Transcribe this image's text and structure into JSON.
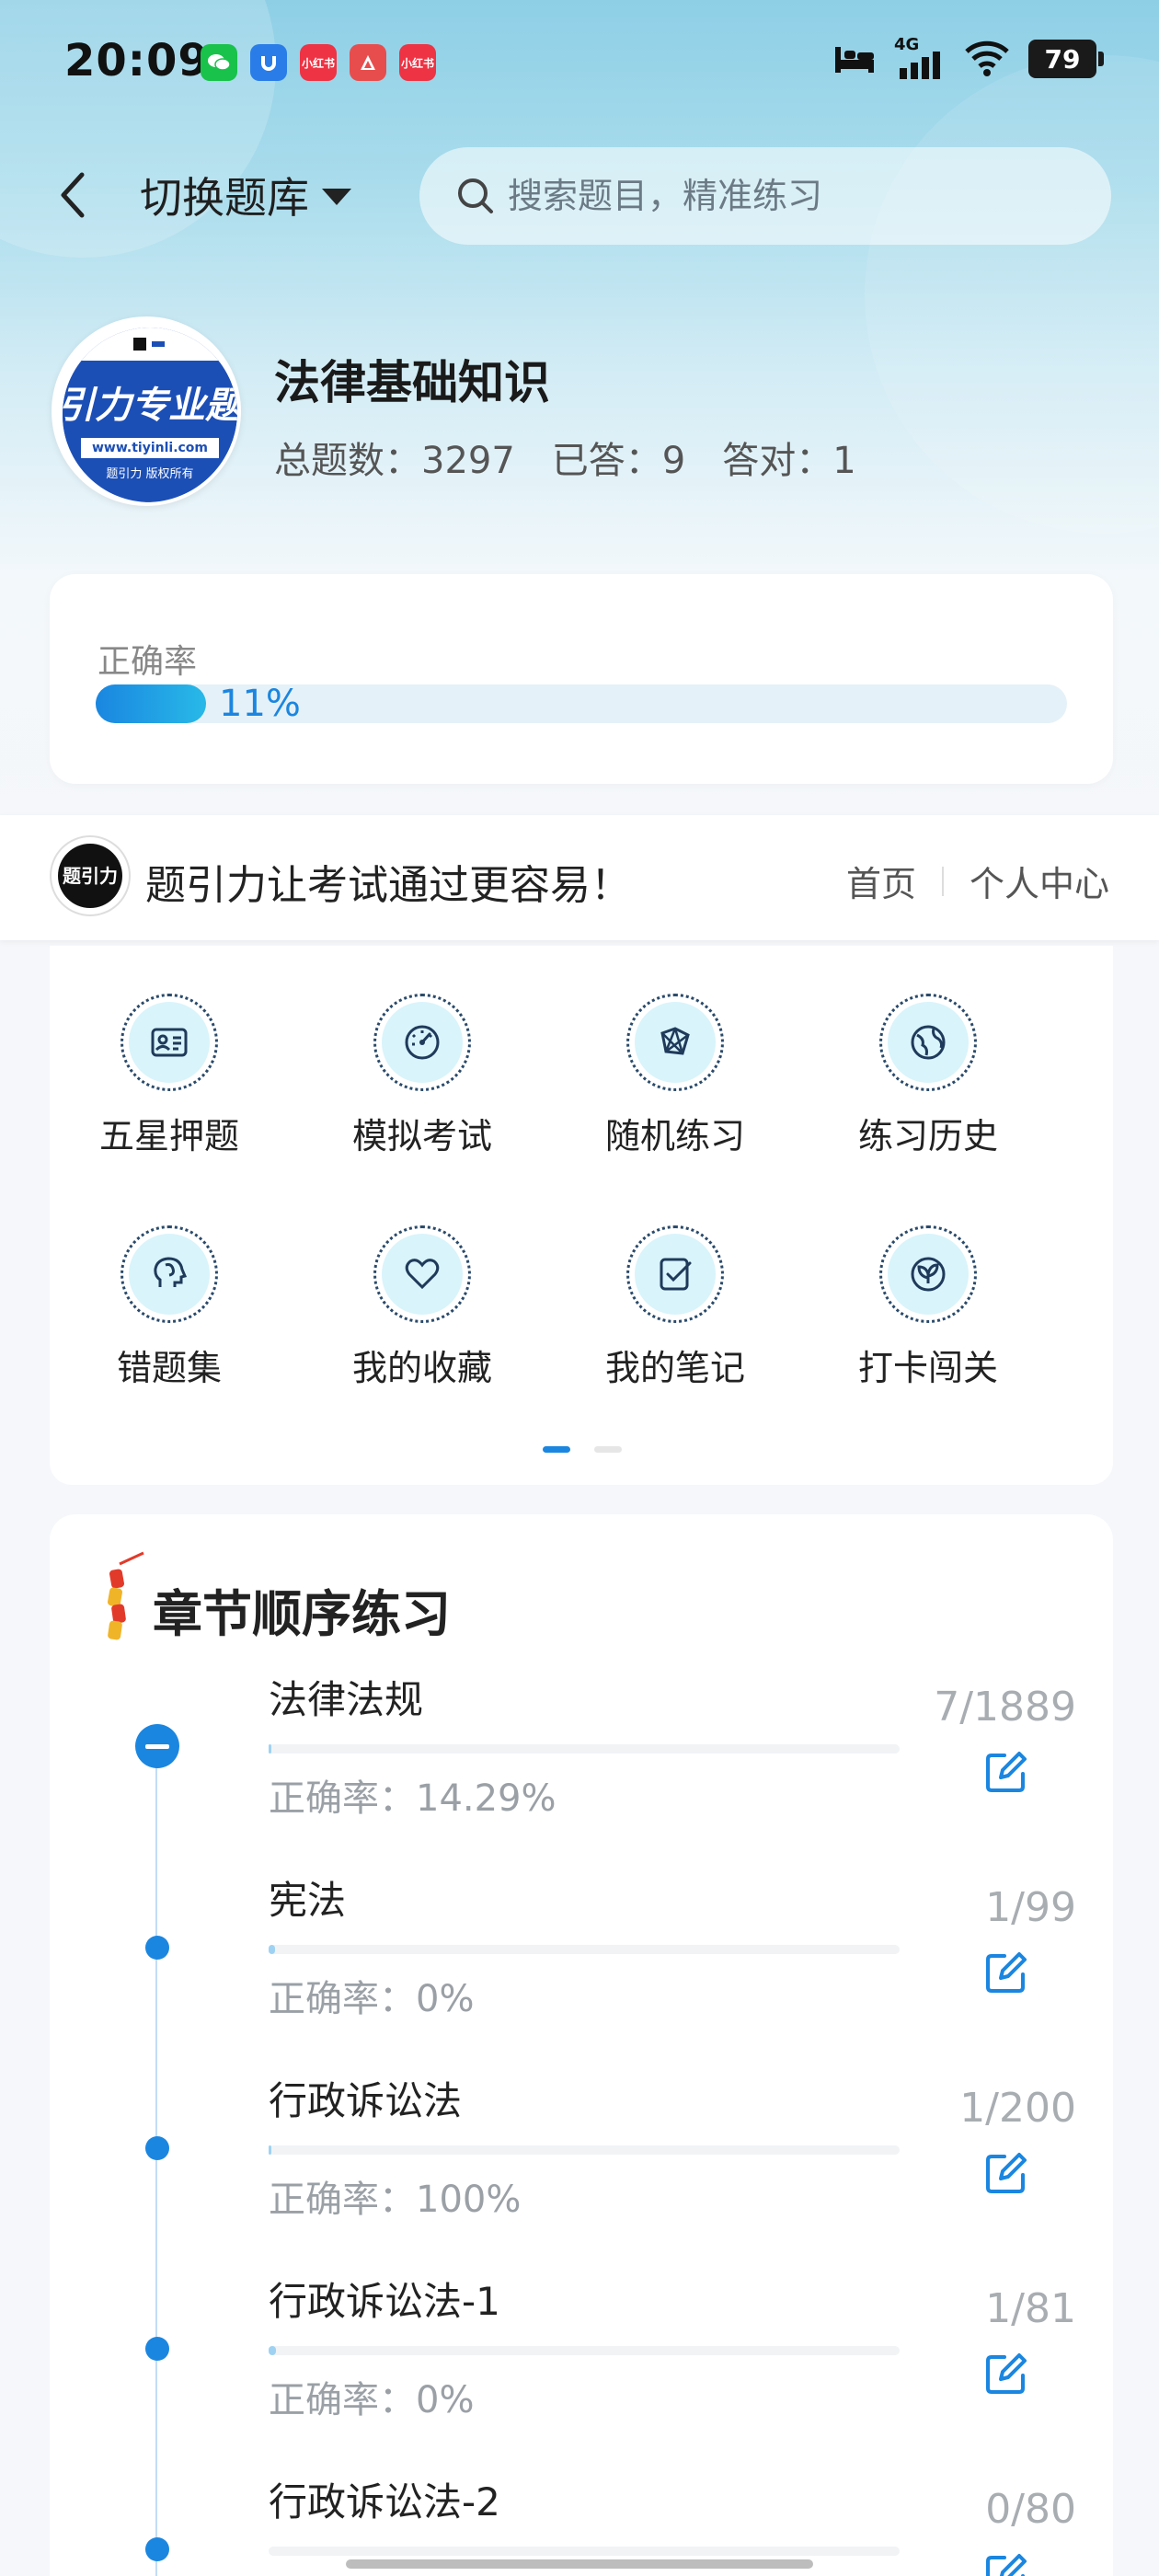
{
  "status_bar": {
    "time": "20:09",
    "apps": [
      {
        "name": "wechat",
        "color": "#19c24a",
        "text": ""
      },
      {
        "name": "u-app",
        "color": "#2a7de8",
        "text": ""
      },
      {
        "name": "xiaohongshu",
        "color": "#ee3344",
        "text": "小红书"
      },
      {
        "name": "a-app",
        "color": "#e84d4d",
        "text": ""
      },
      {
        "name": "xiaohongshu-2",
        "color": "#ee3344",
        "text": "小红书"
      }
    ],
    "network": "4G",
    "battery": "79"
  },
  "nav": {
    "switch_label": "切换题库",
    "search_placeholder": "搜索题目，精准练习"
  },
  "bank": {
    "logo_text": "引力专业题",
    "logo_url": "www.tiyinli.com",
    "logo_copyright": "题引力 版权所有",
    "title": "法律基础知识",
    "total": "总题数：3297",
    "answered": "已答：9",
    "correct": "答对：1"
  },
  "accuracy": {
    "label": "正确率",
    "value_text": "11%",
    "fraction": 0.11
  },
  "banner": {
    "slogan": "题引力让考试通过更容易！",
    "links": [
      "首页",
      "个人中心"
    ],
    "logo_mark": "题引力"
  },
  "features": [
    {
      "label": "五星押题",
      "icon": "id-card-icon"
    },
    {
      "label": "模拟考试",
      "icon": "gauge-icon"
    },
    {
      "label": "随机练习",
      "icon": "network-icon"
    },
    {
      "label": "练习历史",
      "icon": "globe-icon"
    },
    {
      "label": "错题集",
      "icon": "brain-icon"
    },
    {
      "label": "我的收藏",
      "icon": "heart-icon"
    },
    {
      "label": "我的笔记",
      "icon": "note-check-icon"
    },
    {
      "label": "打卡闯关",
      "icon": "leaf-badge-icon"
    }
  ],
  "colors": {
    "accent": "#1b86e0",
    "icon_bg": "#d9f4fb"
  },
  "chapters": {
    "title": "章节顺序练习",
    "items": [
      {
        "name": "法律法规",
        "accuracy": "正确率：14.29%",
        "count": "7/1889",
        "progress": 0.0037,
        "expanded": true
      },
      {
        "name": "宪法",
        "accuracy": "正确率：0%",
        "count": "1/99",
        "progress": 0.0101,
        "expanded": false
      },
      {
        "name": "行政诉讼法",
        "accuracy": "正确率：100%",
        "count": "1/200",
        "progress": 0.005,
        "expanded": false
      },
      {
        "name": "行政诉讼法-1",
        "accuracy": "正确率：0%",
        "count": "1/81",
        "progress": 0.0123,
        "expanded": false
      },
      {
        "name": "行政诉讼法-2",
        "accuracy": "",
        "count": "0/80",
        "progress": 0,
        "expanded": false
      }
    ]
  }
}
